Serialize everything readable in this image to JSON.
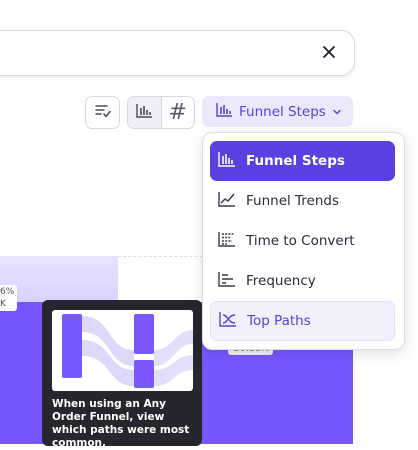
{
  "search": {
    "clear_icon": "close-icon"
  },
  "toolbar": {
    "view_options_icon": "list-check-icon",
    "chart_icon": "bar-chart-icon",
    "table_icon": "hash-icon",
    "hash_symbol": "#",
    "dropdown_label": "Funnel Steps",
    "dropdown_icon": "bar-chart-icon",
    "chevron_icon": "chevron-down-icon"
  },
  "menu": {
    "items": [
      {
        "label": "Funnel Steps",
        "icon": "bar-chart-icon",
        "state": "selected"
      },
      {
        "label": "Funnel Trends",
        "icon": "line-chart-icon",
        "state": "normal"
      },
      {
        "label": "Time to Convert",
        "icon": "time-to-convert-icon",
        "state": "normal"
      },
      {
        "label": "Frequency",
        "icon": "frequency-icon",
        "state": "normal"
      },
      {
        "label": "Top Paths",
        "icon": "paths-icon",
        "state": "hovered"
      }
    ]
  },
  "chart": {
    "edge_label_top": "6%",
    "edge_label_bottom": "K",
    "value_chip": "10.35K",
    "bar_color": "#7856ff",
    "bar_light_color": "#d9d2ff"
  },
  "tooltip": {
    "caption": "When using an Any Order Funnel, view which paths were most common."
  },
  "colors": {
    "accent": "#5b3fe0",
    "accent_light": "#ebe8fb"
  }
}
